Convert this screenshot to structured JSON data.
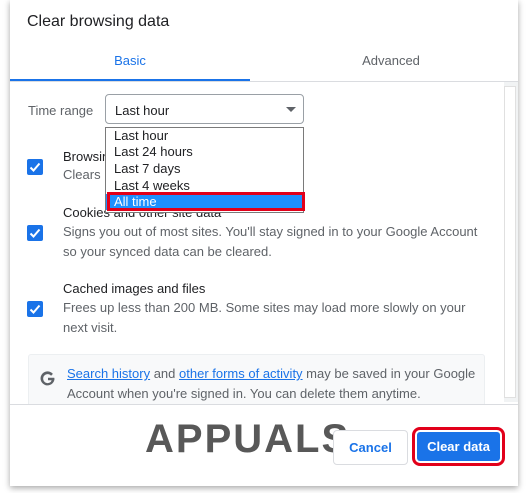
{
  "dialog": {
    "title": "Clear browsing data"
  },
  "tabs": [
    {
      "label": "Basic",
      "active": true
    },
    {
      "label": "Advanced",
      "active": false
    }
  ],
  "time_range": {
    "label": "Time range",
    "selected": "Last hour",
    "options": [
      "Last hour",
      "Last 24 hours",
      "Last 7 days",
      "Last 4 weeks",
      "All time"
    ],
    "highlighted": "All time"
  },
  "items": [
    {
      "title": "Browsing history",
      "desc": "Clears history from all signed-in devices",
      "checked": true
    },
    {
      "title": "Cookies and other site data",
      "desc": "Signs you out of most sites. You'll stay signed in to your Google Account so your synced data can be cleared.",
      "checked": true
    },
    {
      "title": "Cached images and files",
      "desc": "Frees up less than 200 MB. Some sites may load more slowly on your next visit.",
      "checked": true
    }
  ],
  "info": {
    "link1": "Search history",
    "text1": " and ",
    "link2": "other forms of activity",
    "text2": " may be saved in your Google Account when you're signed in. You can delete them anytime."
  },
  "watermark": "APPUALS",
  "buttons": {
    "cancel": "Cancel",
    "clear": "Clear data"
  },
  "colors": {
    "accent": "#1a73e8",
    "highlight": "#e2001a",
    "selected_option": "#1e90ff"
  }
}
